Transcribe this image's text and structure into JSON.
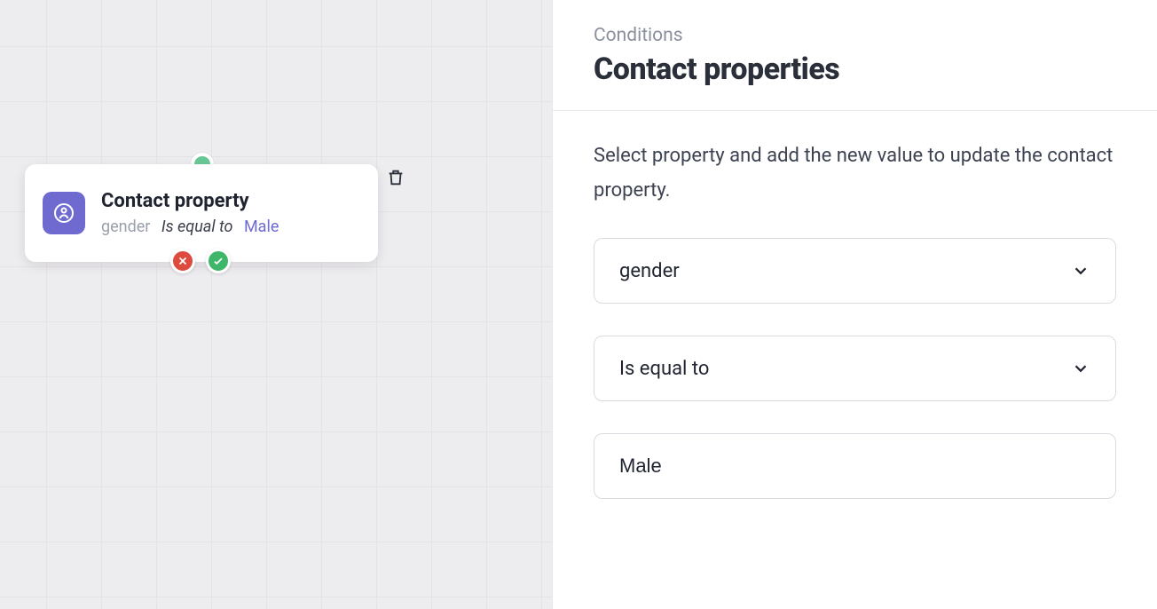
{
  "canvas": {
    "node": {
      "title": "Contact property",
      "property": "gender",
      "operator": "Is equal to",
      "value": "Male"
    }
  },
  "panel": {
    "eyebrow": "Conditions",
    "title": "Contact properties",
    "description": "Select property and add the new value to update the contact property.",
    "property_select": "gender",
    "operator_select": "Is equal to",
    "value_input": "Male"
  }
}
